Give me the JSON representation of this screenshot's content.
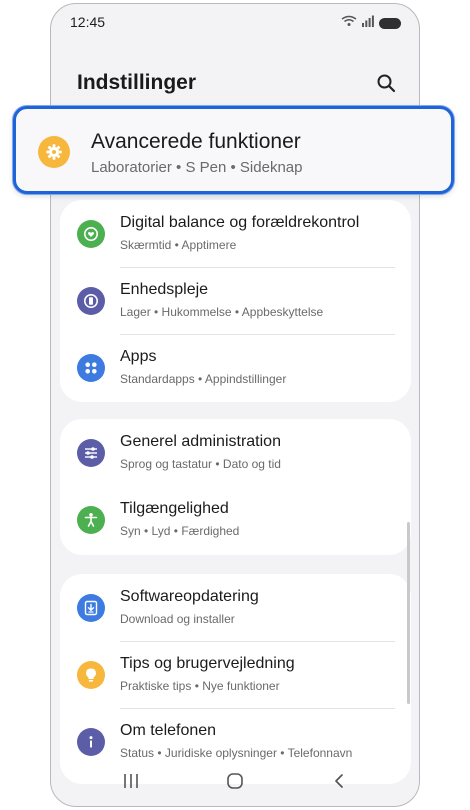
{
  "status_bar": {
    "time": "12:45"
  },
  "header": {
    "title": "Indstillinger"
  },
  "highlight": {
    "title": "Avancerede funktioner",
    "subtitle": "Laboratorier  •  S Pen  •  Sideknap",
    "icon": "gear-icon",
    "icon_color": "#f6b73c",
    "border_color": "#1f64d6"
  },
  "groups": [
    {
      "items": [
        {
          "title": "Digital balance og forældrekontrol",
          "subtitle": "Skærmtid  •  Apptimere",
          "icon": "heart-icon",
          "color": "#4caf50"
        },
        {
          "title": "Enhedspleje",
          "subtitle": "Lager  •  Hukommelse  •  Appbeskyttelse",
          "icon": "device-care-icon",
          "color": "#5b5ea6"
        },
        {
          "title": "Apps",
          "subtitle": "Standardapps  •  Appindstillinger",
          "icon": "apps-icon",
          "color": "#3d7be0"
        }
      ]
    },
    {
      "items": [
        {
          "title": "Generel administration",
          "subtitle": "Sprog og tastatur  •  Dato og tid",
          "icon": "sliders-icon",
          "color": "#5b5ea6"
        },
        {
          "title": "Tilgængelighed",
          "subtitle": "Syn  •  Lyd  •  Færdighed",
          "icon": "accessibility-icon",
          "color": "#4caf50"
        }
      ]
    },
    {
      "items": [
        {
          "title": "Softwareopdatering",
          "subtitle": "Download og installer",
          "icon": "download-icon",
          "color": "#3d7be0"
        },
        {
          "title": "Tips og brugervejledning",
          "subtitle": "Praktiske tips  •  Nye funktioner",
          "icon": "lightbulb-icon",
          "color": "#f6b73c"
        },
        {
          "title": "Om telefonen",
          "subtitle": "Status  •  Juridiske oplysninger  •  Telefonnavn",
          "icon": "info-icon",
          "color": "#5b5ea6"
        }
      ]
    }
  ],
  "colors": {
    "background": "#f3f3f5",
    "card": "#ffffff"
  }
}
